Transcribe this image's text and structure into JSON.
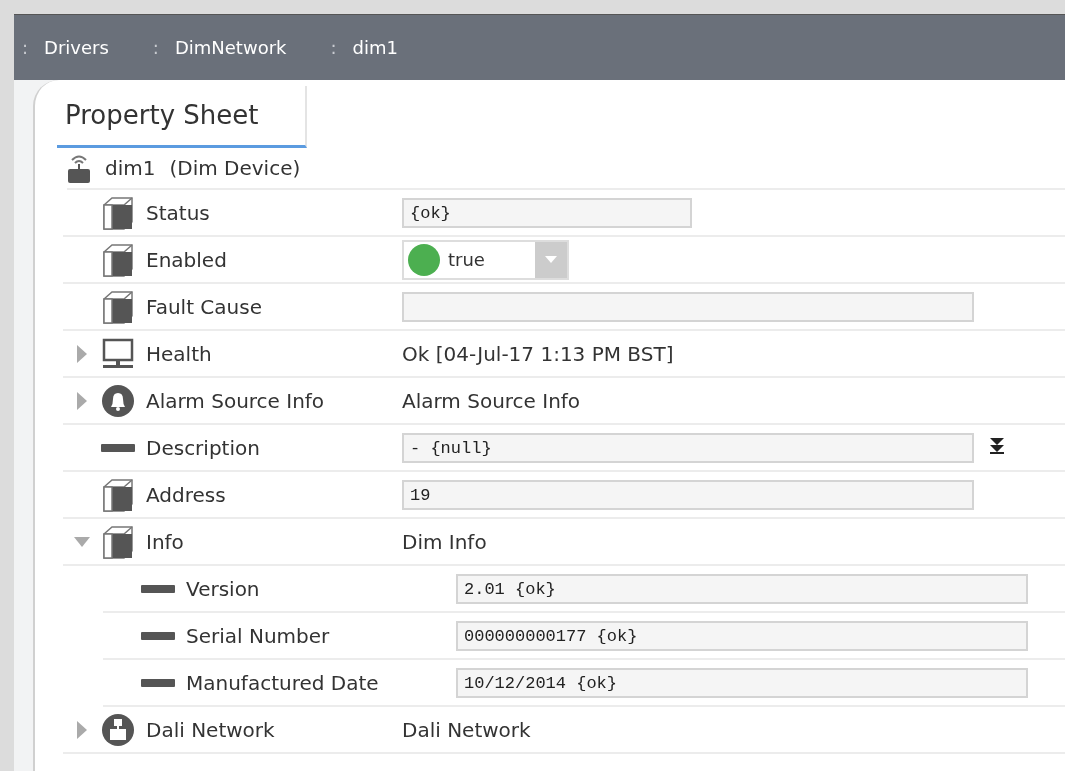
{
  "breadcrumbs": [
    {
      "separator": ":",
      "label": "Drivers"
    },
    {
      "separator": ":",
      "label": "DimNetwork"
    },
    {
      "separator": ":",
      "label": "dim1"
    }
  ],
  "tabs": [
    {
      "label": "Property Sheet",
      "selected": true
    }
  ],
  "root": {
    "name": "dim1",
    "type": "(Dim Device)"
  },
  "properties": [
    {
      "name": "Status",
      "kind": "short-field",
      "value": "{ok}"
    },
    {
      "name": "Enabled",
      "kind": "dropdown",
      "value": "true",
      "on": true
    },
    {
      "name": "Fault Cause",
      "kind": "field"
    },
    {
      "name": "Health",
      "kind": "text",
      "value": "Ok [04-Jul-17 1:13 PM BST]",
      "expanded": false
    },
    {
      "name": "Alarm Source Info",
      "kind": "text",
      "value": "Alarm Source Info",
      "expanded": false
    },
    {
      "name": "Description",
      "kind": "menu-field",
      "value": "- {null}"
    },
    {
      "name": "Address",
      "kind": "field",
      "value": "19"
    },
    {
      "name": "Info",
      "kind": "text",
      "value": "Dim Info",
      "expanded": true,
      "children": [
        {
          "name": "Version",
          "kind": "field",
          "value": "2.01 {ok}"
        },
        {
          "name": "Serial Number",
          "kind": "field",
          "value": "000000000177 {ok}"
        },
        {
          "name": "Manufactured Date",
          "kind": "field",
          "value": "10/12/2014 {ok}"
        }
      ]
    },
    {
      "name": "Dali Network",
      "kind": "text",
      "value": "Dali Network",
      "expanded": false
    }
  ]
}
